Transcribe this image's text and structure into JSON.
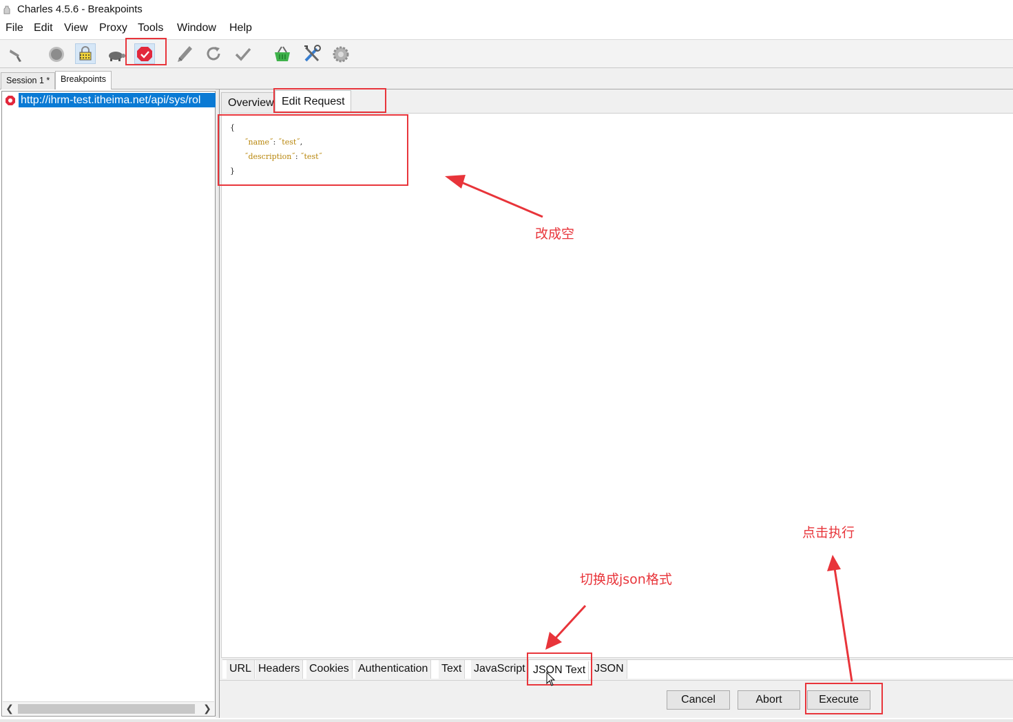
{
  "window": {
    "title": "Charles 4.5.6 - Breakpoints"
  },
  "menu": [
    "File",
    "Edit",
    "View",
    "Proxy",
    "Tools",
    "Window",
    "Help"
  ],
  "toolbar": {
    "buttons": [
      "broom-icon",
      "record-icon",
      "ssl-proxy-icon",
      "throttle-turtle-icon",
      "breakpoints-icon",
      "compose-pen-icon",
      "repeat-icon",
      "validate-check-icon",
      "shopping-basket-icon",
      "tools-icon",
      "settings-gear-icon"
    ],
    "active": [
      "ssl-proxy-icon",
      "breakpoints-icon"
    ]
  },
  "session_tabs": [
    {
      "label": "Session 1 *",
      "active": false
    },
    {
      "label": "Breakpoints",
      "active": true
    }
  ],
  "breakpoint_list": {
    "items": [
      {
        "url": "http://ihrm-test.itheima.net/api/sys/rol",
        "selected": true
      }
    ]
  },
  "request_tabs": [
    {
      "label": "Overview",
      "active": false
    },
    {
      "label": "Edit Request",
      "active": true
    }
  ],
  "editor": {
    "open_brace": "{",
    "lines": [
      {
        "key": "˝name˝",
        "value": "˝test˝",
        "suffix": ","
      },
      {
        "key": "˝description˝",
        "value": "˝test˝",
        "suffix": ""
      }
    ],
    "close_brace": "}"
  },
  "view_tabs": [
    {
      "label": "URL",
      "active": false
    },
    {
      "label": "Headers",
      "active": false
    },
    {
      "label": "Cookies",
      "active": false
    },
    {
      "label": "Authentication",
      "active": false
    },
    {
      "label": "Text",
      "active": false
    },
    {
      "label": "JavaScript",
      "active": false
    },
    {
      "label": "JSON Text",
      "active": true
    },
    {
      "label": "JSON",
      "active": false
    }
  ],
  "actions": {
    "cancel": "Cancel",
    "abort": "Abort",
    "execute": "Execute"
  },
  "annotations": {
    "clear_body": "改成空",
    "switch_json": "切换成json格式",
    "click_execute": "点击执行",
    "color": "#e8343a"
  }
}
